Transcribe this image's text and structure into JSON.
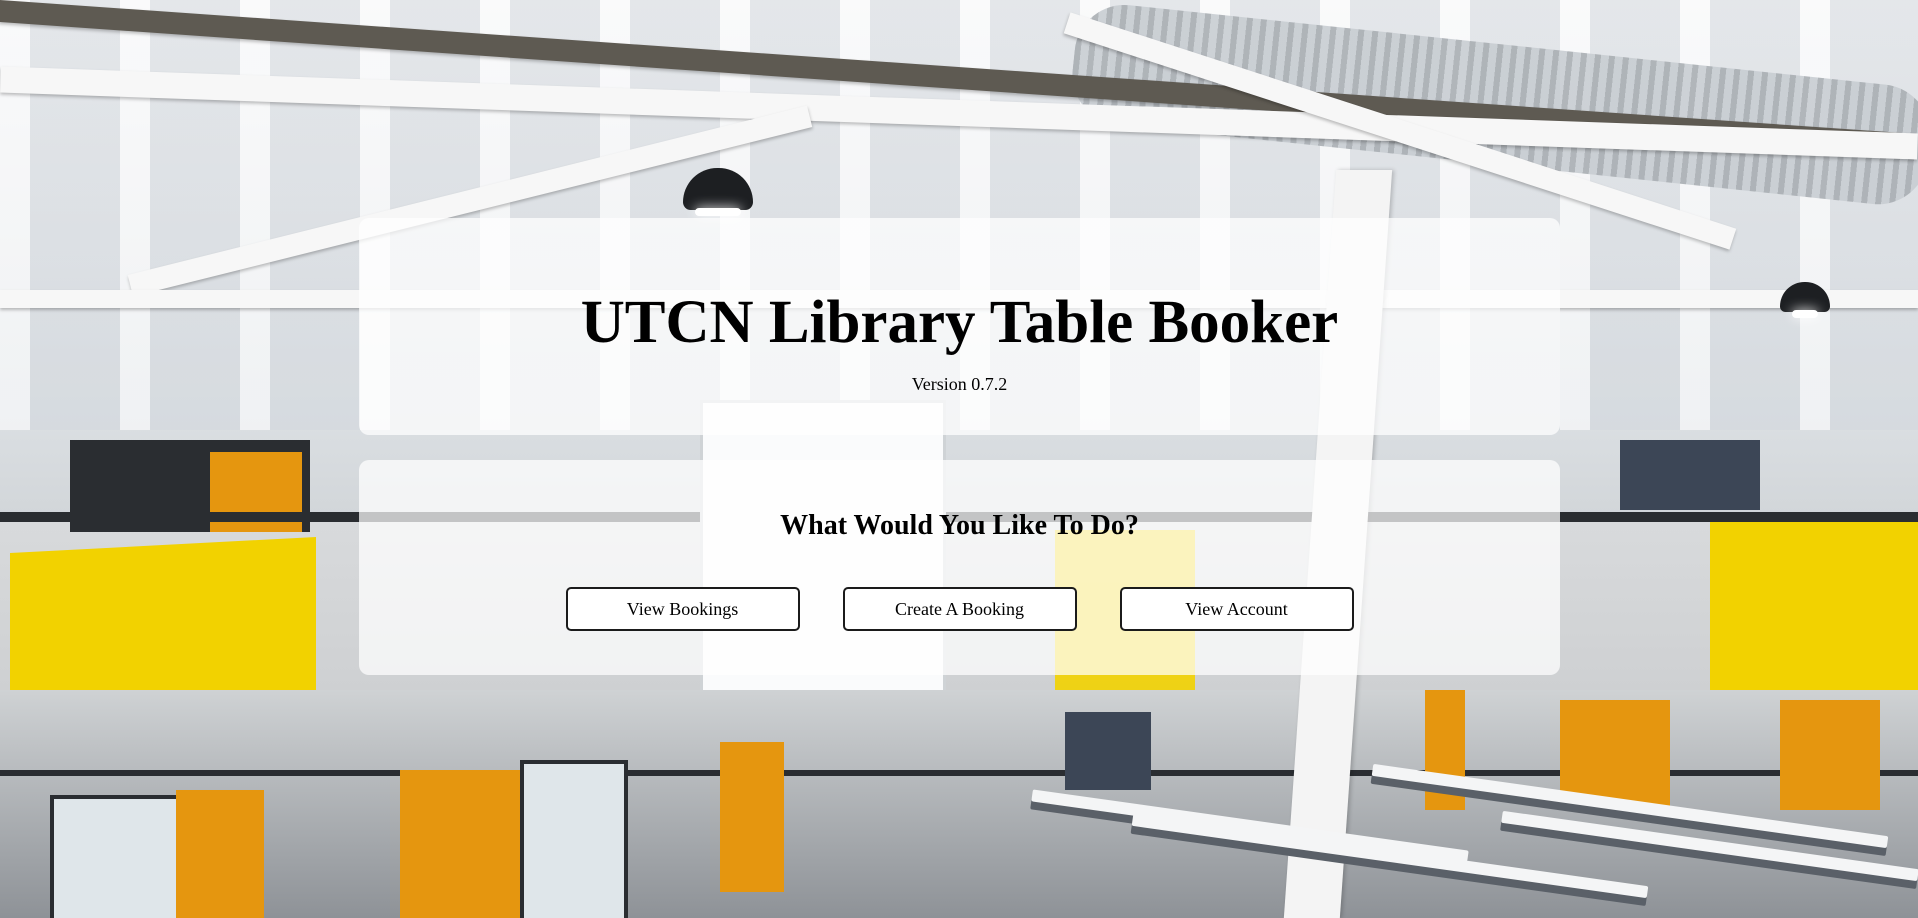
{
  "header": {
    "title": "UTCN Library Table Booker",
    "version": "Version 0.7.2"
  },
  "actions": {
    "prompt": "What Would You Like To Do?",
    "buttons": [
      {
        "label": "View Bookings"
      },
      {
        "label": "Create A Booking"
      },
      {
        "label": "View Account"
      }
    ]
  },
  "background": {
    "accent_colors": [
      "#f2d200",
      "#e5960f"
    ]
  }
}
